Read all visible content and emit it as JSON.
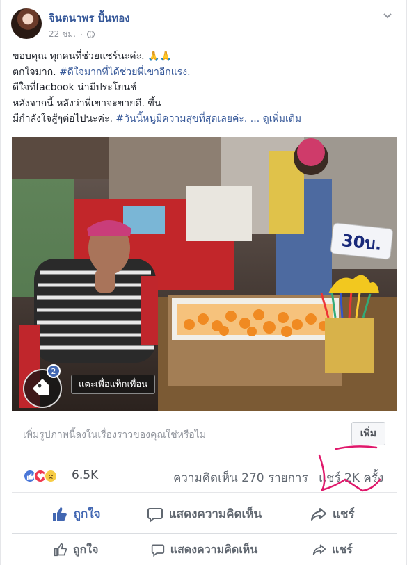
{
  "post": {
    "author": "จินตนาพร ปั้นทอง",
    "time": "22 ชม.",
    "lines": [
      {
        "text": "ขอบคุณ ทุกคนที่ช่วยแชร์นะค่ะ. 🙏🙏",
        "hashtag": "",
        "more": ""
      },
      {
        "text": "ตกใจมาก. ",
        "hashtag": "#ดีใจมากที่ได้ช่วยพี่เขาอีกแรง.",
        "more": ""
      },
      {
        "text": "ดีใจที่facbook น่ามีประโยนช์",
        "hashtag": "",
        "more": ""
      },
      {
        "text": "หลังจากนี้ หลังว่าพี่เขาจะขายดี. ขึ้น",
        "hashtag": "",
        "more": ""
      },
      {
        "text": "มีกำลังใจสู้ๆต่อไปนะค่ะ. ",
        "hashtag": "#วันนี้หนูมีความสุขที่สุดเลยค่ะ.",
        "more": " ... ดูเพิ่มเติม"
      }
    ],
    "photo": {
      "price_sign": "30บ.",
      "tag_count": "2",
      "tag_prompt": "แตะเพื่อแท็กเพื่อน"
    },
    "suggest": {
      "text": "เพิ่มรูปภาพนี้ลงในเรื่องราวของคุณใช่หรือไม่",
      "button": "เพิ่ม"
    },
    "stats": {
      "reactions": "6.5K",
      "comments": "ความคิดเห็น 270 รายการ",
      "shares": "แชร์ 2K ครั้ง"
    },
    "actions": {
      "like": "ถูกใจ",
      "comment": "แสดงความคิดเห็น",
      "share": "แชร์"
    },
    "actions_repeat": {
      "like": "ถูกใจ",
      "comment": "แสดงความคิดเห็น",
      "share": "แชร์"
    }
  },
  "colors": {
    "link": "#365899",
    "liked": "#4267b2",
    "annotation": "#e0186b"
  }
}
